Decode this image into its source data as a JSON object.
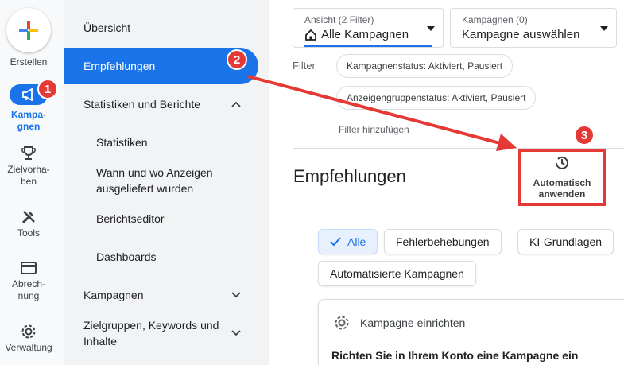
{
  "rail": {
    "create_label": "Erstellen",
    "items": [
      {
        "label": "Kampa-\ngnen",
        "icon": "megaphone-icon"
      },
      {
        "label": "Zielvorha-\nben",
        "icon": "trophy-icon"
      },
      {
        "label": "Tools",
        "icon": "tools-icon"
      },
      {
        "label": "Abrech-\nnung",
        "icon": "credit-card-icon"
      },
      {
        "label": "Verwaltung",
        "icon": "gear-icon"
      }
    ]
  },
  "nav": {
    "overview": "Übersicht",
    "recommendations": "Empfehlungen",
    "stats_reports": "Statistiken und Berichte",
    "stats": "Statistiken",
    "where_when": "Wann und wo Anzeigen ausgeliefert wurden",
    "report_editor": "Berichtseditor",
    "dashboards": "Dashboards",
    "campaigns": "Kampagnen",
    "audiences": "Zielgruppen, Keywords und Inhalte"
  },
  "main": {
    "view_caption": "Ansicht (2 Filter)",
    "view_value": "Alle Kampagnen",
    "campaign_caption": "Kampagnen (0)",
    "campaign_value": "Kampagne auswählen",
    "filter_label": "Filter",
    "chip_campaign_status": "Kampagnenstatus: Aktiviert, Pausiert",
    "chip_adgroup_status": "Anzeigengruppenstatus: Aktiviert, Pausiert",
    "add_filter": "Filter hinzufügen",
    "page_title": "Empfehlungen",
    "auto_apply_line1": "Automatisch",
    "auto_apply_line2": "anwenden",
    "filters": [
      "Alle",
      "Fehlerbehebungen",
      "KI-Grundlagen",
      "Automatisierte Kampagnen"
    ],
    "card_head": "Kampagne einrichten",
    "card_title": "Richten Sie in Ihrem Konto eine Kampagne ein"
  },
  "annotations": {
    "badge1": "1",
    "badge2": "2",
    "badge3": "3",
    "color": "#e53935"
  },
  "colors": {
    "accent": "#1a73e8"
  }
}
